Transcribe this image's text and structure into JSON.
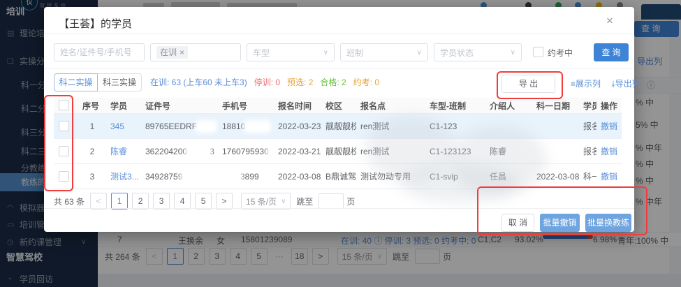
{
  "icons": {
    "close": "×",
    "chevron": "∨",
    "tag_close": "×",
    "info": "ⓘ",
    "list_glyph": "≡",
    "download_glyph": "⤓"
  },
  "sidebar": {
    "logo": "仅",
    "logo_caption": "管理系统",
    "section1": "培训",
    "section2": "智慧驾校",
    "items": [
      {
        "label": "理论培训",
        "icon": "document-icon",
        "glyph": "▤"
      },
      {
        "label": "实操分教",
        "icon": "layers-icon",
        "glyph": "❏"
      },
      {
        "label": "科一分教",
        "sub": true
      },
      {
        "label": "科二分教",
        "sub": true
      },
      {
        "label": "科三分教",
        "sub": true
      },
      {
        "label": "科二三分教",
        "sub": true
      },
      {
        "label": "分教练训",
        "sub": true
      },
      {
        "label": "教练的学员",
        "sub": true,
        "active": true
      },
      {
        "label": "模拟器",
        "icon": "simulator-icon",
        "glyph": "◠"
      },
      {
        "label": "培训管理",
        "icon": "training-manage-icon",
        "glyph": "▭"
      },
      {
        "label": "新约课管理",
        "icon": "clock-icon",
        "glyph": "◷",
        "chevron": true
      }
    ],
    "items2": [
      {
        "label": "学员回访",
        "icon": "user-return-icon",
        "glyph": "◔"
      }
    ]
  },
  "topbar": {
    "icon_dots": [
      "#4a90e2",
      "#444444",
      "#34a853",
      "#4a90e2",
      "#fbbc05",
      "#8a8a8a"
    ]
  },
  "modal": {
    "title": "【王荟】的学员",
    "filters": {
      "name_placeholder": "姓名/证件号/手机号",
      "status_tag": "在训",
      "selects": [
        "车型",
        "班制",
        "学员状态"
      ],
      "approve_checkbox": "约考中",
      "search_button": "查 询"
    },
    "tabs": [
      {
        "label": "科二实操",
        "active": true
      },
      {
        "label": "科三实操",
        "active": false
      }
    ],
    "stats": [
      {
        "text": "在训: 63 (上车60 未上车3)",
        "color": "#5b8fd9"
      },
      {
        "text": "停训: 0",
        "color": "#f56c6c"
      },
      {
        "text": "预选: 2",
        "color": "#e6a23c"
      },
      {
        "text": "合格: 2",
        "color": "#67c23a"
      },
      {
        "text": "约考: 0",
        "color": "#e6a23c"
      }
    ],
    "export_button": "导 出",
    "column_links": [
      {
        "glyph": "≡",
        "label": "展示列",
        "icon": "columns-icon"
      },
      {
        "glyph": "⤓",
        "label": "导出列",
        "icon": "export-columns-icon"
      }
    ],
    "table": {
      "headers": [
        "序号",
        "学员",
        "证件号",
        "手机号",
        "报名时间",
        "校区",
        "报名点",
        "车型-班制",
        "介绍人",
        "科一日期",
        "学员状态",
        "操作"
      ],
      "rows": [
        {
          "highlight": true,
          "cells": [
            "1",
            [
              {
                "l": "345"
              }
            ],
            [
              "89765EEDRF",
              {
                "s": 26
              }
            ],
            [
              "18810",
              {
                "s": 34
              }
            ],
            "2022-03-23",
            "靓靓靓校区",
            "ren测试",
            "C1-123",
            "",
            "",
            "报名成功",
            [
              {
                "l": "撤销"
              }
            ]
          ]
        },
        {
          "highlight": false,
          "cells": [
            "2",
            [
              {
                "l": "陈睿"
              }
            ],
            [
              "362204200",
              {
                "s": 32
              },
              "3"
            ],
            [
              "1760795930",
              {
                "s": 8
              }
            ],
            "2022-03-21",
            "靓靓靓校区",
            "ren测试",
            "C1-123123",
            "陈睿",
            "",
            "报名成功",
            [
              {
                "l": "撤销"
              }
            ]
          ]
        },
        {
          "highlight": false,
          "cells": [
            "3",
            [
              {
                "l": "测试3..."
              }
            ],
            [
              "34928759",
              {
                "s": 34
              }
            ],
            [
              {
                "s": 26
              },
              "3899"
            ],
            "2022-03-08",
            "B鼎诚驾校...",
            "测试勿动专用",
            "C1-svip",
            "任昌",
            "2022-03-08",
            "科一合格",
            [
              {
                "l": "撤销"
              }
            ]
          ]
        }
      ]
    },
    "pagination": {
      "total": "共 63 条",
      "buttons": [
        "<",
        "1",
        "2",
        "3",
        "4",
        "5",
        ">"
      ],
      "active": "1",
      "page_size": "15 条/页",
      "jump_label": "跳至",
      "page_unit": "页"
    },
    "footer": {
      "cancel": "取 消",
      "batch_revoke": "批量撤销",
      "batch_change": "批量换教练"
    }
  },
  "background": {
    "search_button": "查 询",
    "export_col_link": "导出列",
    "info_icon": "ⓘ",
    "right_fragments": [
      "% 中",
      "5% 中",
      "% 中年",
      "% 中",
      "% 中",
      "% 中年"
    ],
    "row7": {
      "no": "7",
      "name": "王换余",
      "gender": "女",
      "phone": "15801239089",
      "stats": "在训: 40 ⓘ 停训: 3 预选: 0 约考中: 0",
      "car_types": "C1,C2",
      "pass_rate": "93.02%",
      "fail_rate": "6.98%",
      "age_dist": "青年:100% 中"
    },
    "pagination": {
      "total": "共 264 条",
      "buttons": [
        "<",
        "1",
        "2",
        "3",
        "4",
        "5",
        "···",
        "18",
        ">"
      ],
      "active": "1",
      "page_size": "15 条/页",
      "jump_label": "跳至",
      "page_unit": "页"
    }
  }
}
